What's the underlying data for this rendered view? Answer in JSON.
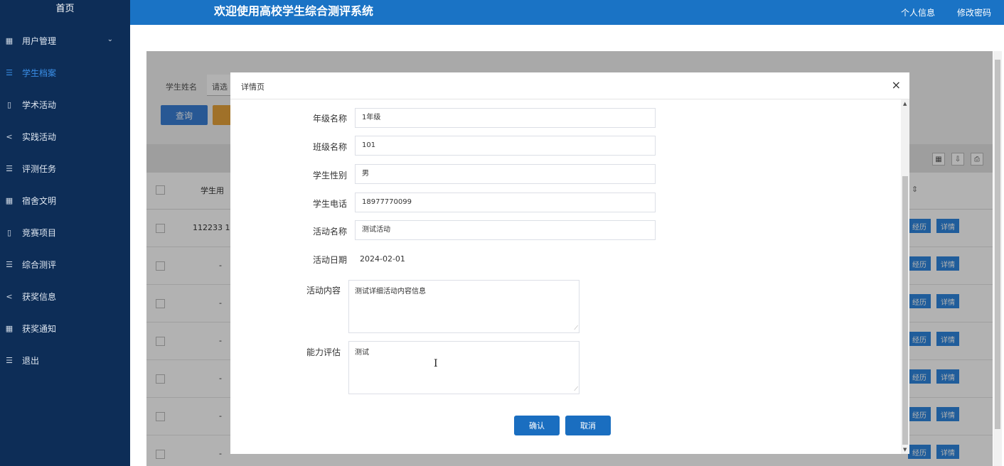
{
  "sidebar": {
    "home_label": "首页",
    "items": [
      {
        "label": "用户管理",
        "icon": "grid-icon",
        "has_chevron": true
      },
      {
        "label": "学生档案",
        "icon": "list-icon",
        "active": true
      },
      {
        "label": "学术活动",
        "icon": "book-icon"
      },
      {
        "label": "实践活动",
        "icon": "share-icon"
      },
      {
        "label": "评测任务",
        "icon": "list-icon"
      },
      {
        "label": "宿舍文明",
        "icon": "grid-icon"
      },
      {
        "label": "竞赛项目",
        "icon": "book-icon"
      },
      {
        "label": "综合测评",
        "icon": "list-icon"
      },
      {
        "label": "获奖信息",
        "icon": "share-icon"
      },
      {
        "label": "获奖通知",
        "icon": "grid-icon"
      },
      {
        "label": "退出",
        "icon": "list-icon"
      }
    ]
  },
  "header": {
    "title": "欢迎使用高校学生综合测评系统",
    "profile_link": "个人信息",
    "password_link": "修改密码"
  },
  "background": {
    "search_label": "学生姓名",
    "search_value": "请选",
    "query_button": "查询",
    "table": {
      "column_label": "学生用",
      "first_row_value": "112233 1",
      "placeholder": "-",
      "btn_history": "经历",
      "btn_detail": "详情"
    }
  },
  "modal": {
    "title": "详情页",
    "close_icon": "×",
    "fields": {
      "grade_label": "年级名称",
      "grade_value": "1年级",
      "class_label": "班级名称",
      "class_value": "101",
      "gender_label": "学生性别",
      "gender_value": "男",
      "phone_label": "学生电话",
      "phone_value": "18977770099",
      "activity_label": "活动名称",
      "activity_value": "测试活动",
      "date_label": "活动日期",
      "date_value": "2024-02-01",
      "content_label": "活动内容",
      "content_value": "测试详细活动内容信息",
      "ability_label": "能力评估",
      "ability_value": "测试"
    },
    "confirm_button": "确认",
    "cancel_button": "取消"
  },
  "colors": {
    "sidebar_bg": "#0d2d57",
    "header_bg": "#1a73c5",
    "accent": "#3a8ee6",
    "button_blue": "#1a6ec0"
  }
}
